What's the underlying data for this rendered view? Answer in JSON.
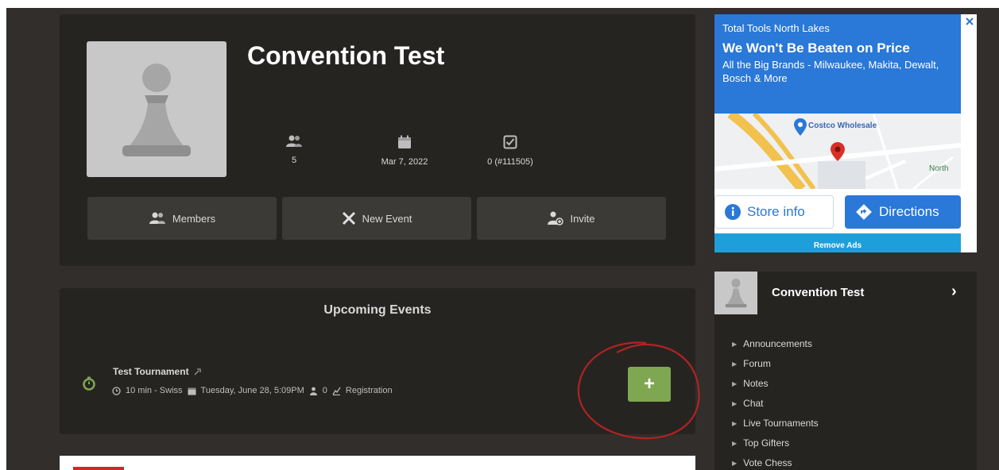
{
  "club": {
    "name": "Convention Test",
    "stats": [
      {
        "icon": "members-icon",
        "value": "5"
      },
      {
        "icon": "calendar-icon",
        "value": "Mar 7, 2022"
      },
      {
        "icon": "checkbox-icon",
        "value": "0 (#111505)"
      }
    ],
    "actions": [
      {
        "label": "Members",
        "icon": "members-icon"
      },
      {
        "label": "New Event",
        "icon": "crossed-swords-icon"
      },
      {
        "label": "Invite",
        "icon": "add-user-icon"
      }
    ]
  },
  "events": {
    "title": "Upcoming Events",
    "items": [
      {
        "name": "Test Tournament",
        "time_control": "10 min - Swiss",
        "date": "Tuesday, June 28, 5:09PM",
        "players": "0",
        "status": "Registration"
      }
    ],
    "add_label": "+"
  },
  "ad": {
    "advertiser": "Total Tools North Lakes",
    "headline": "We Won't Be Beaten on Price",
    "body": "All the Big Brands - Milwaukee, Makita, Dewalt, Bosch & More",
    "map_place": "Costco Wholesale",
    "map_label": "North",
    "store_info": "Store info",
    "directions": "Directions",
    "remove_ads": "Remove Ads",
    "colors": {
      "blue": "#2a78d7",
      "remove_bar": "#1e9fd9"
    }
  },
  "sidebar": {
    "title": "Convention Test",
    "items": [
      "Announcements",
      "Forum",
      "Notes",
      "Chat",
      "Live Tournaments",
      "Top Gifters",
      "Vote Chess"
    ]
  },
  "colors": {
    "page_bg": "#312e2b",
    "panel_bg": "#262421",
    "button_bg": "#3c3a37",
    "accent_green": "#7fa650"
  }
}
